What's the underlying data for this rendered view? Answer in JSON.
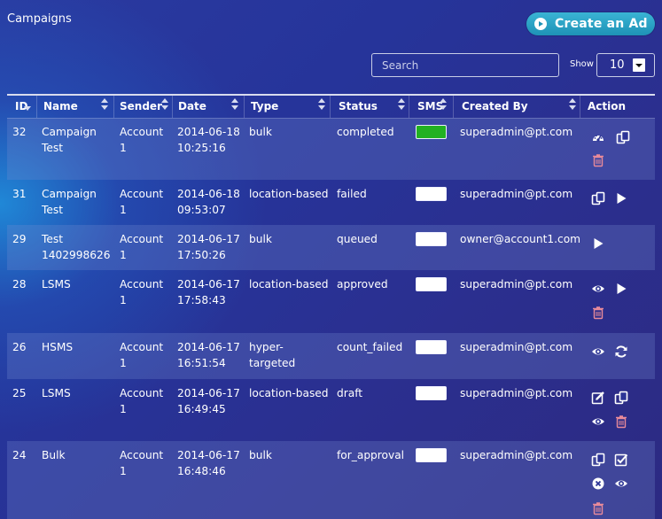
{
  "page": {
    "title": "Campaigns",
    "create_button_label": "Create an Ad"
  },
  "toolbar": {
    "search_placeholder": "Search",
    "show_label": "Show",
    "page_size": "10"
  },
  "colors": {
    "accent_button": "#2aa3c6",
    "sms_ok": "#22b122",
    "delete_icon": "#e88a9a"
  },
  "table": {
    "columns": [
      "ID",
      "Name",
      "Sender",
      "Date",
      "Type",
      "Status",
      "SMS",
      "Created By",
      "Action"
    ],
    "rows": [
      {
        "id": "32",
        "name": "Campaign\nTest",
        "sender": "Account\n1",
        "date": "2014-06-18\n10:25:16",
        "type": "bulk",
        "status": "completed",
        "sms": "green",
        "created_by": "superadmin@pt.com",
        "actions": [
          "dashboard-icon",
          "copy-icon",
          "trash-icon"
        ]
      },
      {
        "id": "31",
        "name": "Campaign\nTest",
        "sender": "Account\n1",
        "date": "2014-06-18\n09:53:07",
        "type": "location-based",
        "status": "failed",
        "sms": "white",
        "created_by": "superadmin@pt.com",
        "actions": [
          "copy-icon",
          "play-icon"
        ]
      },
      {
        "id": "29",
        "name": "Test\n1402998626",
        "sender": "Account\n1",
        "date": "2014-06-17\n17:50:26",
        "type": "bulk",
        "status": "queued",
        "sms": "white",
        "created_by": "owner@account1.com",
        "actions": [
          "play-icon"
        ]
      },
      {
        "id": "28",
        "name": "LSMS",
        "sender": "Account\n1",
        "date": "2014-06-17\n17:58:43",
        "type": "location-based",
        "status": "approved",
        "sms": "white",
        "created_by": "superadmin@pt.com",
        "actions": [
          "eye-icon",
          "play-icon",
          "trash-icon"
        ]
      },
      {
        "id": "26",
        "name": "HSMS",
        "sender": "Account\n1",
        "date": "2014-06-17\n16:51:54",
        "type": "hyper-\ntargeted",
        "status": "count_failed",
        "sms": "white",
        "created_by": "superadmin@pt.com",
        "actions": [
          "eye-icon",
          "refresh-icon"
        ]
      },
      {
        "id": "25",
        "name": "LSMS",
        "sender": "Account\n1",
        "date": "2014-06-17\n16:49:45",
        "type": "location-based",
        "status": "draft",
        "sms": "white",
        "created_by": "superadmin@pt.com",
        "actions": [
          "edit-icon",
          "copy-icon",
          "eye-icon",
          "trash-icon"
        ]
      },
      {
        "id": "24",
        "name": "Bulk",
        "sender": "Account\n1",
        "date": "2014-06-17\n16:48:46",
        "type": "bulk",
        "status": "for_approval",
        "sms": "white",
        "created_by": "superadmin@pt.com",
        "actions": [
          "copy-icon",
          "check-icon",
          "cancel-icon",
          "eye-icon",
          "trash-icon"
        ]
      }
    ]
  }
}
